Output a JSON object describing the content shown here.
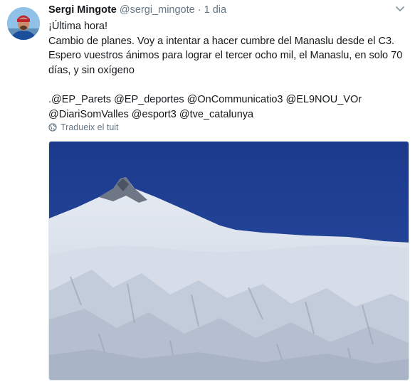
{
  "tweet": {
    "display_name": "Sergi Mingote",
    "handle": "@sergi_mingote",
    "separator": "·",
    "time": "1 dia",
    "lines": [
      "¡Última hora!",
      "Cambio de planes. Voy a intentar a hacer cumbre del Manaslu desde el C3.",
      "Espero vuestros ánimos para lograr el tercer ocho mil, el Manaslu, en solo 70",
      "días, y sin oxígeno"
    ],
    "mentions_line1": ".@EP_Parets @EP_deportes @OnCommunicatio3 @EL9NOU_VOr",
    "mentions_line2": "@DiariSomValles @esport3 @tve_catalunya",
    "translate_label": "Tradueix el tuit"
  },
  "icons": {
    "caret": "chevron-down-icon",
    "globe": "globe-icon"
  },
  "colors": {
    "text": "#14171a",
    "secondary": "#657786",
    "sky": "#1f3b8a"
  }
}
